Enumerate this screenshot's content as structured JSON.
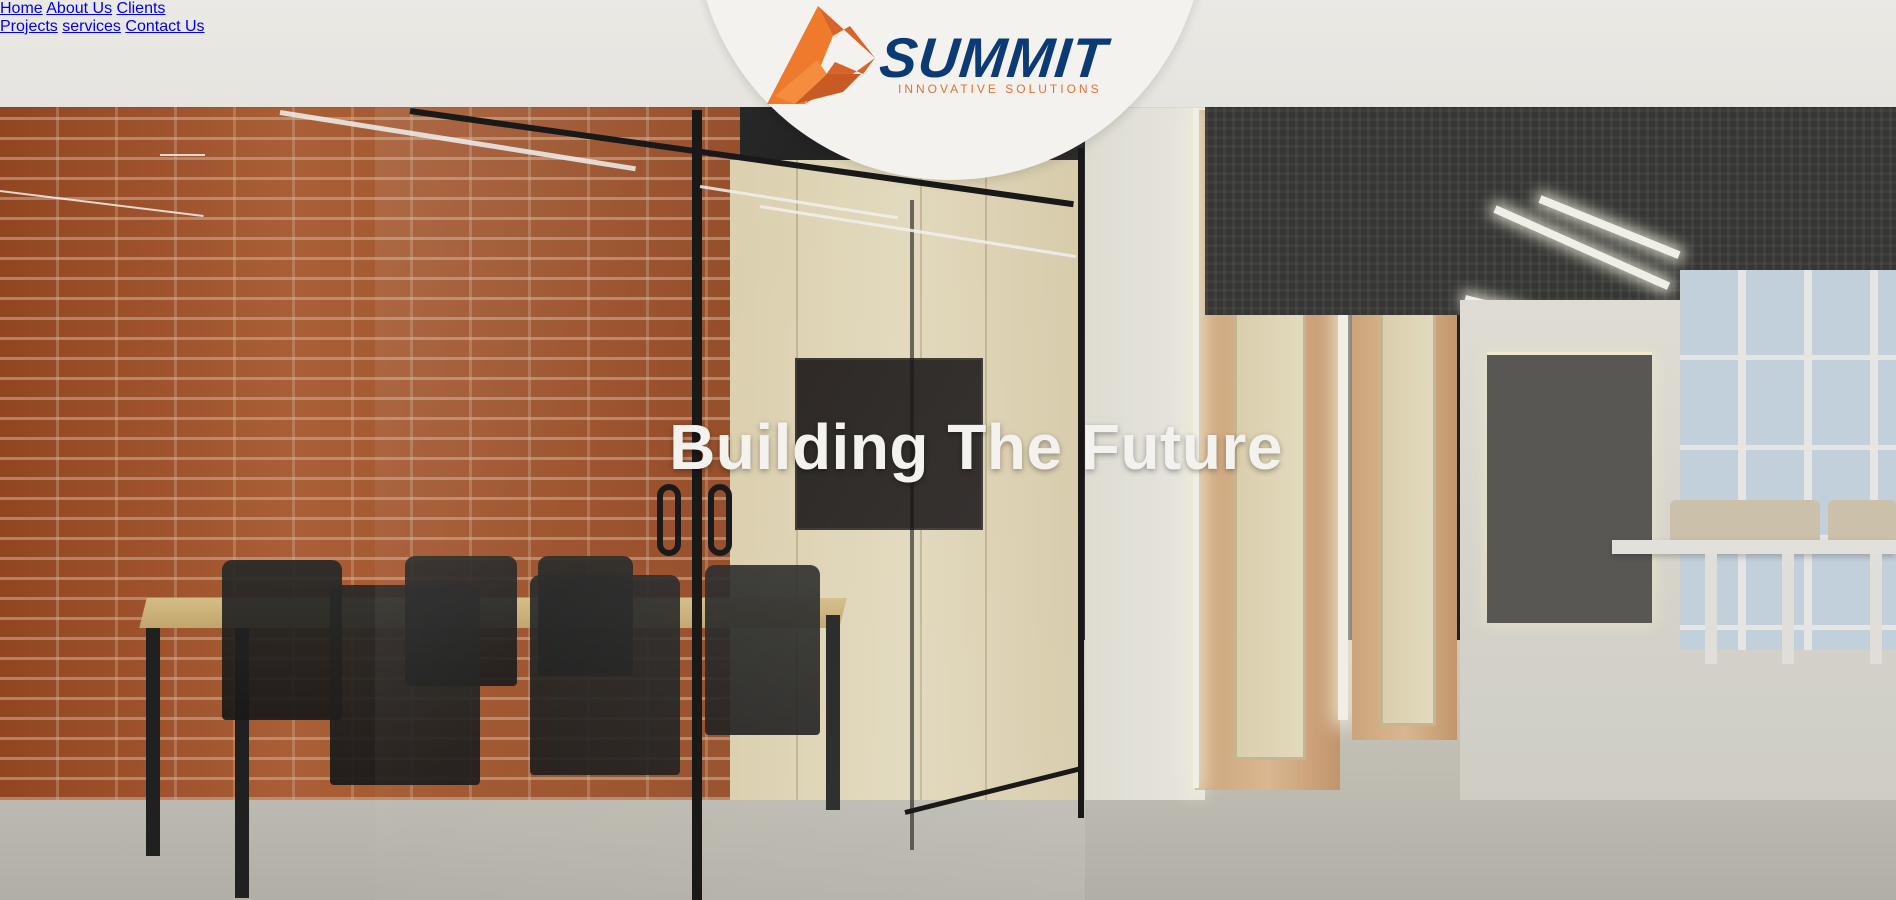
{
  "brand": {
    "name": "SUMMIT",
    "tagline": "INNOVATIVE SOLUTIONS",
    "colors": {
      "primary_blue": "#0c3a75",
      "accent_orange": "#e2712e"
    }
  },
  "nav": {
    "left": [
      {
        "label": "Home"
      },
      {
        "label": "About Us"
      },
      {
        "label": "Clients"
      }
    ],
    "right": [
      {
        "label": "Projects"
      },
      {
        "label": "services"
      },
      {
        "label": "Contact Us"
      }
    ]
  },
  "hero": {
    "title": "Building The Future",
    "background": "office-interior-photo"
  }
}
